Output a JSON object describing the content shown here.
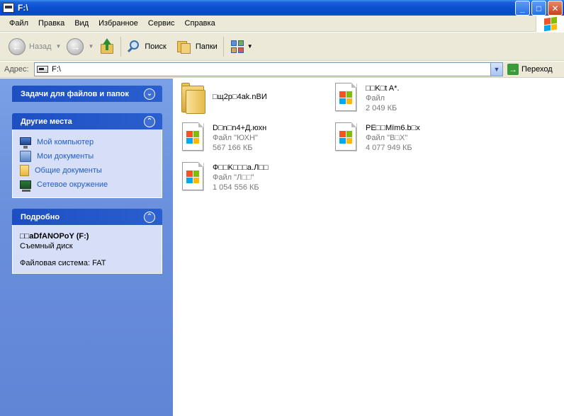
{
  "window": {
    "title": "F:\\"
  },
  "menu": [
    "Файл",
    "Правка",
    "Вид",
    "Избранное",
    "Сервис",
    "Справка"
  ],
  "toolbar": {
    "back_label": "Назад",
    "search_label": "Поиск",
    "folders_label": "Папки"
  },
  "address": {
    "label": "Адрес:",
    "value": "F:\\",
    "go_label": "Переход"
  },
  "taskpane": {
    "file_tasks": {
      "title": "Задачи для файлов и папок"
    },
    "other_places": {
      "title": "Другие места",
      "items": [
        "Мой компьютер",
        "Мои документы",
        "Общие документы",
        "Сетевое окружение"
      ]
    },
    "details": {
      "title": "Подробно",
      "name": "□□aDfANOPoY (F:)",
      "type": "Съемный диск",
      "fs": "Файловая система: FAT"
    }
  },
  "files": [
    {
      "kind": "folder",
      "name": "□щ2p□4ak.nВИ"
    },
    {
      "kind": "file",
      "name": "□□K□t A*.",
      "type": "Файл",
      "size": "2 049 КБ"
    },
    {
      "kind": "file",
      "name": "D□n□n4+Д.юхн",
      "type": "Файл \"ЮХН\"",
      "size": "567 166 КБ"
    },
    {
      "kind": "file",
      "name": "PE□□Mïm6.b□x",
      "type": "Файл \"B□X\"",
      "size": "4 077 949 КБ"
    },
    {
      "kind": "file",
      "name": "Ф□□K□□□a.Л□□",
      "type": "Файл \"Л□□\"",
      "size": "1 054 556 КБ"
    }
  ]
}
